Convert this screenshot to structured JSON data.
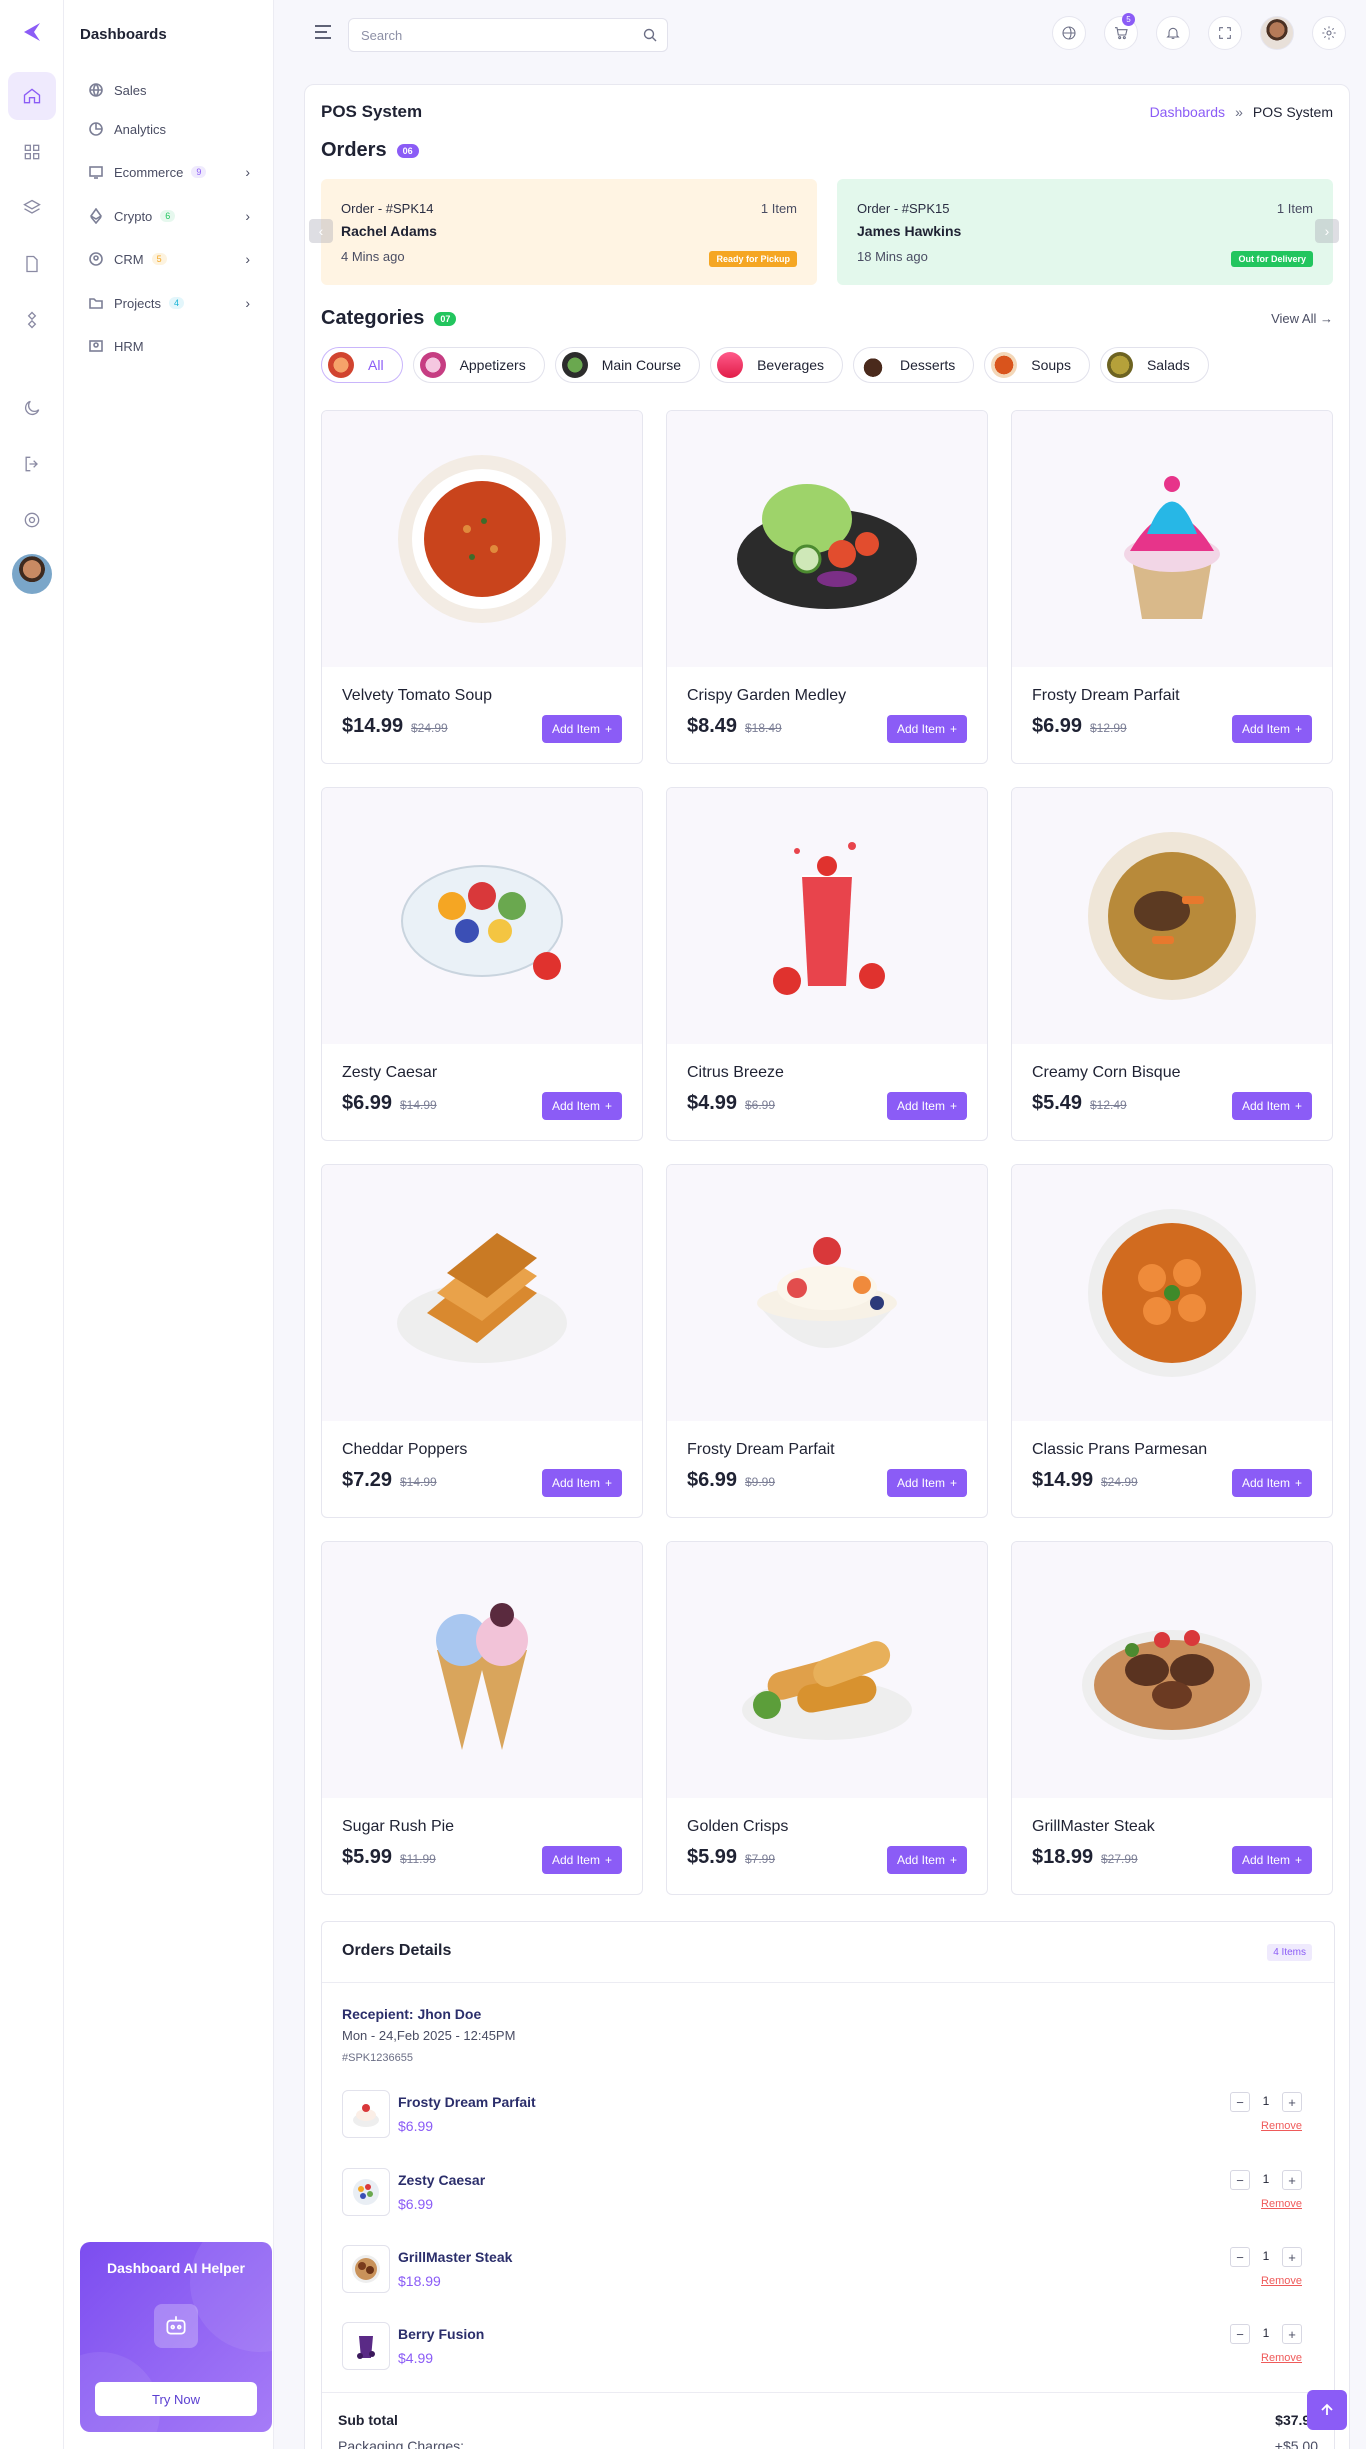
{
  "sidebar": {
    "brand": "Dashboards",
    "items": [
      {
        "label": "Sales"
      },
      {
        "label": "Analytics"
      },
      {
        "label": "Ecommerce",
        "badge": "9"
      },
      {
        "label": "Crypto",
        "badge": "6"
      },
      {
        "label": "CRM",
        "badge": "5"
      },
      {
        "label": "Projects",
        "badge": "4"
      },
      {
        "label": "HRM"
      }
    ]
  },
  "ai_helper": {
    "title": "Dashboard AI Helper",
    "button": "Try Now"
  },
  "header": {
    "search_placeholder": "Search",
    "cart_count": "5"
  },
  "page": {
    "title": "POS System",
    "breadcrumb": {
      "link": "Dashboards",
      "separator": "»",
      "current": "POS System"
    }
  },
  "orders": {
    "title": "Orders",
    "count": "06",
    "cards": [
      {
        "id": "Order - #SPK14",
        "items": "1 Item",
        "name": "Rachel Adams",
        "time": "4 Mins ago",
        "status": "Ready for Pickup"
      },
      {
        "id": "Order - #SPK15",
        "items": "1 Item",
        "name": "James Hawkins",
        "time": "18 Mins ago",
        "status": "Out for Delivery"
      }
    ]
  },
  "categories": {
    "title": "Categories",
    "count": "07",
    "view_all": "View All",
    "items": [
      "All",
      "Appetizers",
      "Main Course",
      "Beverages",
      "Desserts",
      "Soups",
      "Salads"
    ]
  },
  "products": [
    {
      "name": "Velvety Tomato Soup",
      "price": "$14.99",
      "old": "$24.99",
      "add": "Add Item",
      "image": "tomato-soup"
    },
    {
      "name": "Crispy Garden Medley",
      "price": "$8.49",
      "old": "$18.49",
      "add": "Add Item",
      "image": "garden-salad"
    },
    {
      "name": "Frosty Dream Parfait",
      "price": "$6.99",
      "old": "$12.99",
      "add": "Add Item",
      "image": "cupcake"
    },
    {
      "name": "Zesty Caesar",
      "price": "$6.99",
      "old": "$14.99",
      "add": "Add Item",
      "image": "fruit-bowl"
    },
    {
      "name": "Citrus Breeze",
      "price": "$4.99",
      "old": "$6.99",
      "add": "Add Item",
      "image": "strawberry-juice"
    },
    {
      "name": "Creamy Corn Bisque",
      "price": "$5.49",
      "old": "$12.49",
      "add": "Add Item",
      "image": "meat-soup"
    },
    {
      "name": "Cheddar Poppers",
      "price": "$7.29",
      "old": "$14.99",
      "add": "Add Item",
      "image": "french-toast"
    },
    {
      "name": "Frosty Dream Parfait",
      "price": "$6.99",
      "old": "$9.99",
      "add": "Add Item",
      "image": "cream-bowl"
    },
    {
      "name": "Classic Prans Parmesan",
      "price": "$14.99",
      "old": "$24.99",
      "add": "Add Item",
      "image": "prawns"
    },
    {
      "name": "Sugar Rush Pie",
      "price": "$5.99",
      "old": "$11.99",
      "add": "Add Item",
      "image": "ice-cream-cones"
    },
    {
      "name": "Golden Crisps",
      "price": "$5.99",
      "old": "$7.99",
      "add": "Add Item",
      "image": "spring-rolls"
    },
    {
      "name": "GrillMaster Steak",
      "price": "$18.99",
      "old": "$27.99",
      "add": "Add Item",
      "image": "grilled-chicken-rice"
    }
  ],
  "order_details": {
    "title": "Orders Details",
    "count": "4 Items",
    "recipient": "Recepient: Jhon Doe",
    "date": "Mon - 24,Feb 2025 - 12:45PM",
    "ref": "#SPK1236655",
    "items": [
      {
        "name": "Frosty Dream Parfait",
        "price": "$6.99",
        "qty": "1",
        "remove": "Remove"
      },
      {
        "name": "Zesty Caesar",
        "price": "$6.99",
        "qty": "1",
        "remove": "Remove"
      },
      {
        "name": "GrillMaster Steak",
        "price": "$18.99",
        "qty": "1",
        "remove": "Remove"
      },
      {
        "name": "Berry Fusion",
        "price": "$4.99",
        "qty": "1",
        "remove": "Remove"
      }
    ],
    "subtotal_label": "Sub total",
    "subtotal_value": "$37.96",
    "packaging_label": "Packaging Charges:",
    "packaging_value": "+$5.00"
  },
  "colors": {
    "accent": "#8b5cf6",
    "pickup": "#f5a623",
    "delivery": "#22c55e"
  }
}
